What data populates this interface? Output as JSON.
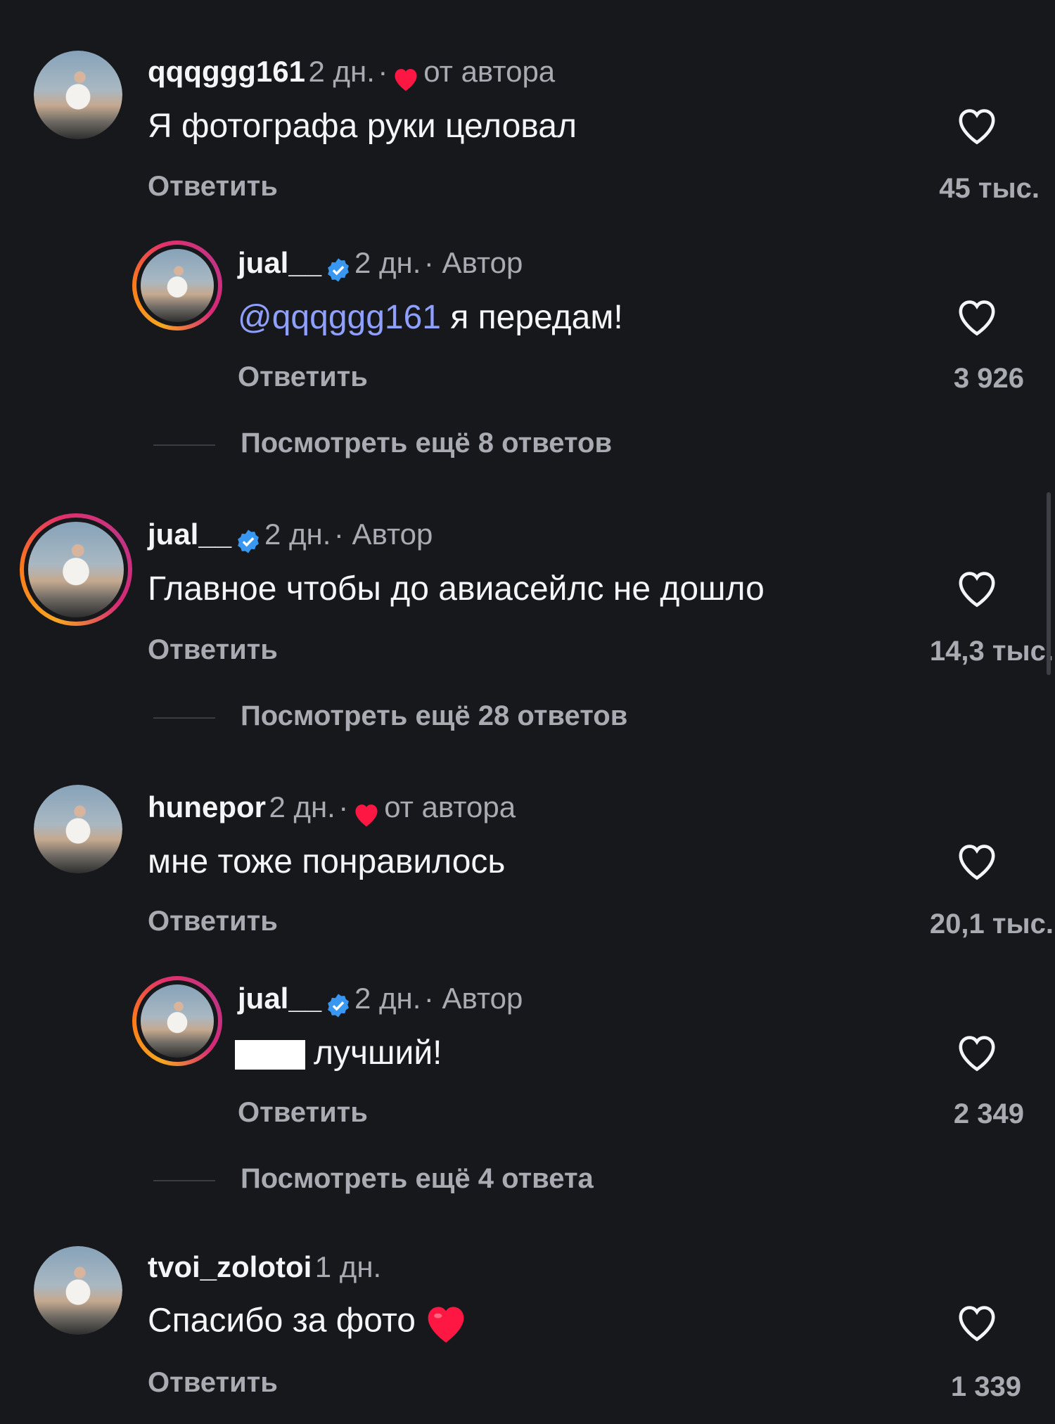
{
  "comments": [
    {
      "username": "qqqggg161",
      "time": "2 дн.",
      "separator": "·",
      "author_like_label": "от автора",
      "text": "Я фотографа руки целовал",
      "reply_label": "Ответить",
      "likes": "45 тыс."
    },
    {
      "username": "jual__",
      "time": "2 дн.",
      "role": "· Автор",
      "mention": "@qqqggg161",
      "text": " я передам!",
      "reply_label": "Ответить",
      "likes": "3 926",
      "more_replies": "Посмотреть ещё 8 ответов"
    },
    {
      "username": "jual__",
      "time": "2 дн.",
      "role": "· Автор",
      "text": "Главное чтобы до авиасейлс не дошло",
      "reply_label": "Ответить",
      "likes": "14,3 тыс.",
      "more_replies": "Посмотреть ещё 28 ответов"
    },
    {
      "username": "hunepor",
      "time": "2 дн.",
      "separator": "·",
      "author_like_label": "от автора",
      "text": "мне тоже понравилось",
      "reply_label": "Ответить",
      "likes": "20,1 тыс."
    },
    {
      "username": "jual__",
      "time": "2 дн.",
      "role": "· Автор",
      "text": "лучший!",
      "reply_label": "Ответить",
      "likes": "2 349",
      "more_replies": "Посмотреть ещё 4 ответа"
    },
    {
      "username": "tvoi_zolotoi",
      "time": "1 дн.",
      "text": "Спасибо за фото",
      "reply_label": "Ответить",
      "likes": "1 339"
    }
  ],
  "colors": {
    "background": "#17181c",
    "text": "#f3f5f7",
    "secondary": "#a8abb1",
    "heart_red": "#ff1744",
    "verified_blue": "#3897f0",
    "mention": "#8fa0ff"
  },
  "icons": [
    "heart-outline-icon",
    "red-heart-icon",
    "verified-badge-icon"
  ]
}
